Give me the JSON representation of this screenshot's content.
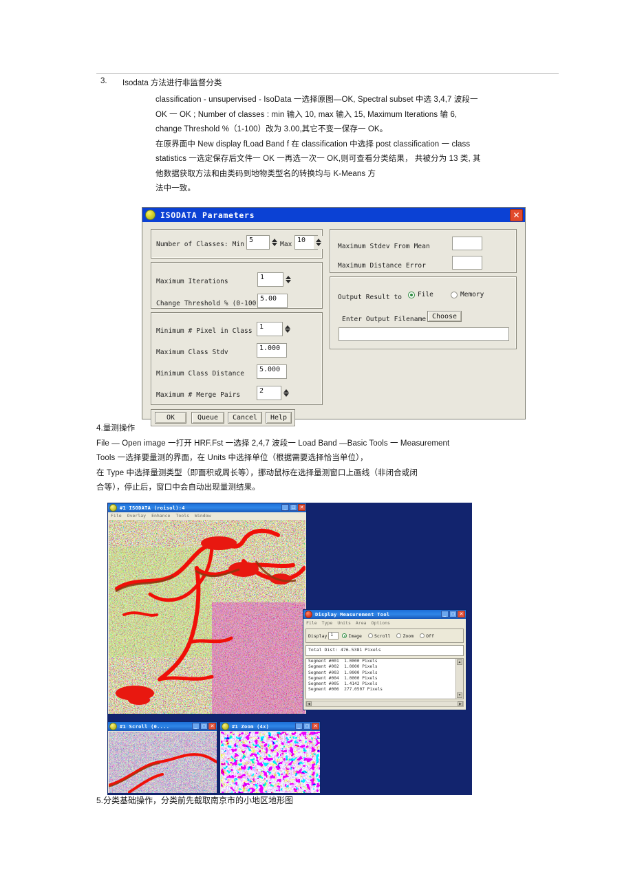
{
  "document": {
    "section_number": "3.",
    "section_title": "Isodata 方法进行非监督分类",
    "para1": [
      "classification - unsupervised - IsoData 一选择原图—OK, Spectral subset 中选  3,4,7 波段一",
      "OK 一 OK ; Number of classes :    min 输入  10, max 输入  15, Maximum Iterations 输  6,",
      "change Threshold %（1-100）改为  3.00,其它不变一保存一  OK。",
      "在原界面中  New display fLoad Band f 在  classification 中选择  post classification 一 class",
      "statistics 一选定保存后文件一 OK 一再选一次一 OK,则可查看分类结果，  共被分为 13 类, 其",
      "他数据获取方法和由类码到地物类型名的转换均与 K-Means 方",
      "法中一致。"
    ],
    "para2": [
      "4.量测操作",
      "File — Open image 一打开  HRF.Fst 一选择  2,4,7 波段一 Load Band —Basic Tools 一  Measurement",
      "Tools 一选择要量测的界面，在  Units 中选择单位（根据需要选择恰当单位），",
      "在 Type 中选择量测类型（即面积或周长等），挪动鼠标在选择量测窗口上画线（非闭合或闭",
      "合等），停止后，窗口中会自动出现量测结果。"
    ],
    "caption5": "5.分类基础操作，分类前先截取南京市的小地区地形图"
  },
  "isodata_dialog": {
    "title": "ISODATA Parameters",
    "title_icon": "envi-globe-icon",
    "close_icon": "✕",
    "fields": {
      "num_classes_label": "Number of Classes:  Min",
      "num_classes_min": "5",
      "num_classes_max_label": "Max",
      "num_classes_max": "10",
      "max_iterations_label": "Maximum Iterations",
      "max_iterations": "1",
      "change_threshold_label": "Change Threshold % (0-100)",
      "change_threshold": "5.00",
      "min_pixel_label": "Minimum # Pixel in Class",
      "min_pixel": "1",
      "max_class_stdv_label": "Maximum Class Stdv",
      "max_class_stdv": "1.000",
      "min_class_distance_label": "Minimum Class Distance",
      "min_class_distance": "5.000",
      "max_merge_pairs_label": "Maximum # Merge Pairs",
      "max_merge_pairs": "2",
      "max_stdev_from_mean_label": "Maximum Stdev From Mean",
      "max_stdev_from_mean": "",
      "max_distance_error_label": "Maximum Distance Error",
      "max_distance_error": "",
      "output_result_label": "Output Result to",
      "output_file_label": "File",
      "output_memory_label": "Memory",
      "output_selected": "File",
      "enter_output_filename_label": "Enter Output Filename",
      "choose_label": "Choose",
      "output_filename": ""
    },
    "buttons": {
      "ok": "OK",
      "queue": "Queue",
      "cancel": "Cancel",
      "help": "Help"
    }
  },
  "envi_desktop": {
    "background_color": "#12246e",
    "image_window": {
      "title": "#1 ISODATA (roisol):4",
      "menu": [
        "File",
        "Overlay",
        "Enhance",
        "Tools",
        "Window"
      ],
      "buttons": [
        "_",
        "□",
        "✕"
      ]
    },
    "scroll_window": {
      "title": "#1 Scroll (0....",
      "buttons": [
        "_",
        "□",
        "✕"
      ]
    },
    "zoom_window": {
      "title": "#1 Zoom (4x)",
      "buttons": [
        "_",
        "□",
        "✕"
      ]
    },
    "measurement_tool": {
      "title": "Display Measurement Tool",
      "menu": [
        "File",
        "Type",
        "Units",
        "Area",
        "Options"
      ],
      "display_label": "Display",
      "display_value": "1",
      "radios": [
        "Image",
        "Scroll",
        "Zoom",
        "Off"
      ],
      "radio_selected": "Image",
      "total_label": "Total Dist: 476.5381 Pixels",
      "segments": [
        "Segment #001  1.0000 Pixels",
        "Segment #002  1.0000 Pixels",
        "Segment #003  1.0000 Pixels",
        "Segment #004  1.0000 Pixels",
        "Segment #005  1.4142 Pixels",
        "Segment #006  277.0507 Pixels"
      ],
      "buttons": [
        "_",
        "□",
        "✕"
      ]
    }
  }
}
